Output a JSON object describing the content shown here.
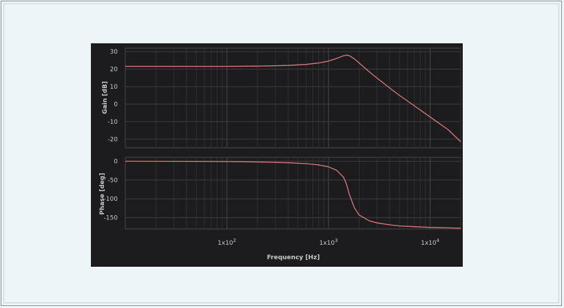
{
  "chart_data": [
    {
      "type": "line",
      "name": "gain-chart",
      "ylabel": "Gain [dB]",
      "xscale": "log",
      "xlim": [
        10,
        20000
      ],
      "ylim": [
        -25,
        32
      ],
      "yticks": [
        -20,
        -10,
        0,
        10,
        20,
        30
      ],
      "grid": true,
      "series": [
        {
          "color": "#e07a7a",
          "x": [
            10,
            50,
            100,
            200,
            400,
            600,
            800,
            1000,
            1200,
            1400,
            1500,
            1600,
            1800,
            2000,
            2500,
            3000,
            4000,
            5000,
            7000,
            10000,
            15000,
            20000
          ],
          "y": [
            21.6,
            21.6,
            21.6,
            21.7,
            22.1,
            22.7,
            23.5,
            24.6,
            26.1,
            27.6,
            28.0,
            27.7,
            25.8,
            23.5,
            18.6,
            14.9,
            9.2,
            4.9,
            -1.0,
            -7.4,
            -14.6,
            -21.5
          ]
        }
      ]
    },
    {
      "type": "line",
      "name": "phase-chart",
      "ylabel": "Phase [deg]",
      "xlabel": "Frequency [Hz]",
      "xscale": "log",
      "xlim": [
        10,
        20000
      ],
      "ylim": [
        -180,
        10
      ],
      "yticks": [
        -150,
        -100,
        -50,
        0
      ],
      "xticks": [
        {
          "value": 100,
          "base": "1x10",
          "exp": "2"
        },
        {
          "value": 1000,
          "base": "1x10",
          "exp": "3"
        },
        {
          "value": 10000,
          "base": "1x10",
          "exp": "4"
        }
      ],
      "grid": true,
      "series": [
        {
          "color": "#e07a7a",
          "x": [
            10,
            50,
            100,
            200,
            400,
            600,
            800,
            1000,
            1200,
            1400,
            1500,
            1600,
            1800,
            2000,
            2500,
            3000,
            4000,
            5000,
            7000,
            10000,
            15000,
            20000
          ],
          "y": [
            0,
            -0.5,
            -1,
            -2,
            -4,
            -6.5,
            -10,
            -15,
            -24,
            -42,
            -60,
            -88,
            -124,
            -143,
            -158,
            -164,
            -169,
            -172,
            -174,
            -176,
            -177,
            -178
          ]
        }
      ]
    }
  ]
}
